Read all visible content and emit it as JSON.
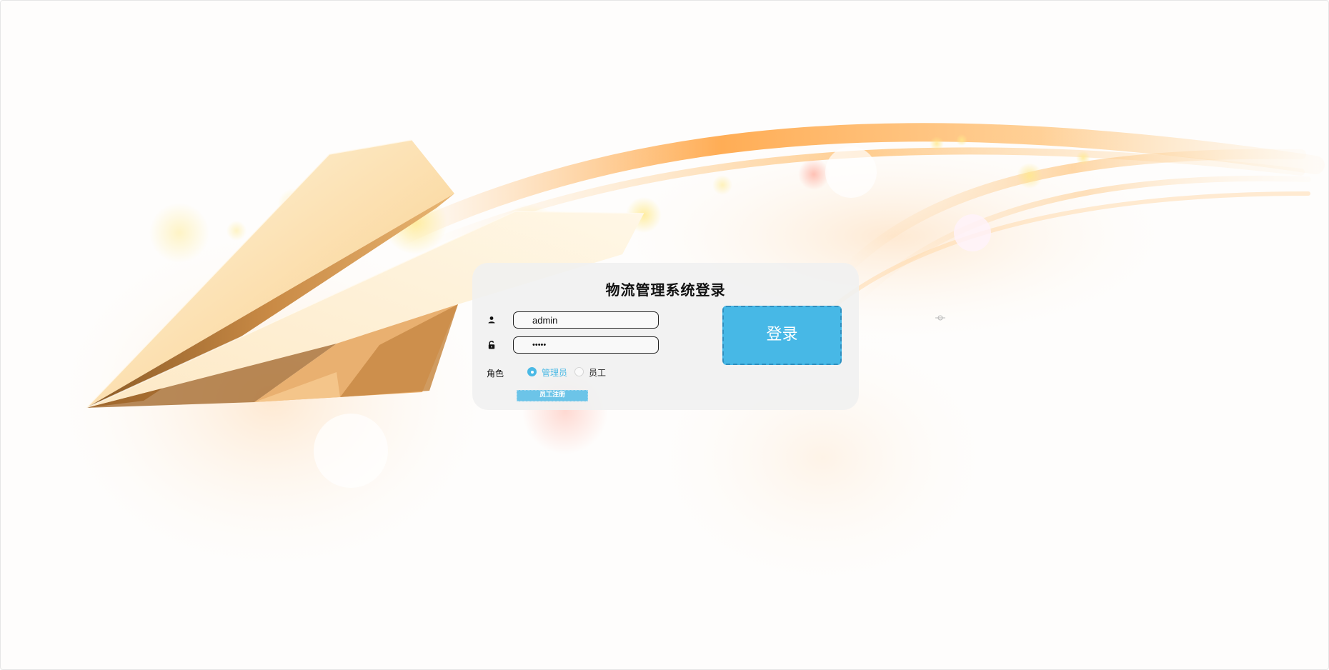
{
  "login": {
    "title": "物流管理系统登录",
    "username_value": "admin",
    "password_value": "•••••",
    "role_label": "角色",
    "roles": [
      {
        "label": "管理员",
        "selected": true
      },
      {
        "label": "员工",
        "selected": false
      }
    ],
    "register_label": "员工注册",
    "login_label": "登录"
  },
  "colors": {
    "accent": "#47b8e6",
    "card_bg": "#f0f0f0"
  },
  "icons": {
    "username": "user-icon",
    "password": "lock-icon"
  }
}
